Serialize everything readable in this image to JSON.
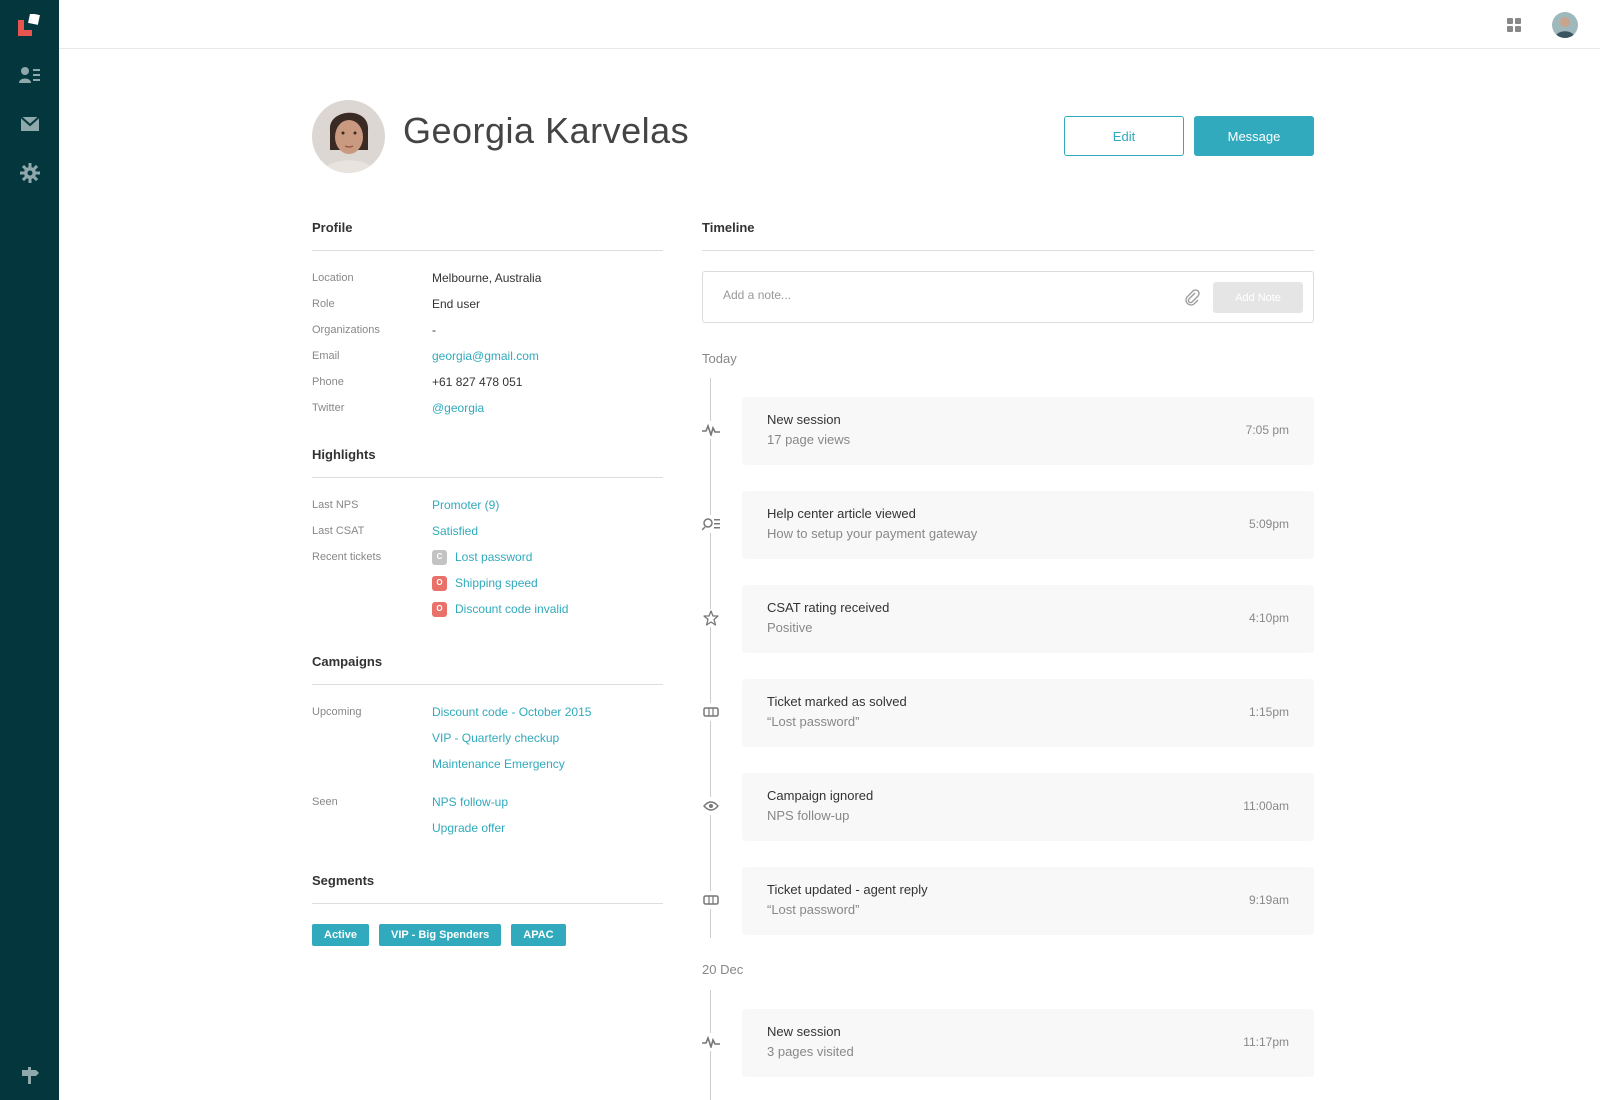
{
  "profile": {
    "name": "Georgia Karvelas",
    "edit_label": "Edit",
    "message_label": "Message"
  },
  "profile_section": {
    "title": "Profile",
    "fields": [
      {
        "key": "Location",
        "value": "Melbourne, Australia"
      },
      {
        "key": "Role",
        "value": "End user"
      },
      {
        "key": "Organizations",
        "value": "-"
      },
      {
        "key": "Email",
        "value": "georgia@gmail.com"
      },
      {
        "key": "Phone",
        "value": "+61 827 478 051"
      },
      {
        "key": "Twitter",
        "value": "@georgia"
      }
    ]
  },
  "highlights": {
    "title": "Highlights",
    "last_nps_label": "Last NPS",
    "last_nps_value": "Promoter (9)",
    "last_csat_label": "Last CSAT",
    "last_csat_value": "Satisfied",
    "recent_tickets_label": "Recent tickets",
    "tickets": [
      {
        "status": "C",
        "title": "Lost password"
      },
      {
        "status": "O",
        "title": "Shipping speed"
      },
      {
        "status": "O",
        "title": "Discount code invalid"
      }
    ]
  },
  "campaigns": {
    "title": "Campaigns",
    "upcoming_label": "Upcoming",
    "upcoming": [
      "Discount code - October 2015",
      "VIP - Quarterly checkup",
      "Maintenance Emergency"
    ],
    "seen_label": "Seen",
    "seen": [
      "NPS follow-up",
      "Upgrade offer"
    ]
  },
  "segments": {
    "title": "Segments",
    "tags": [
      "Active",
      "VIP - Big Spenders",
      "APAC"
    ]
  },
  "timeline": {
    "title": "Timeline",
    "note_placeholder": "Add a note...",
    "add_note_label": "Add Note",
    "day_today": "Today",
    "day_2": "20 Dec",
    "events": [
      {
        "icon": "activity-icon",
        "title": "New session",
        "subtitle": "17 page views",
        "time": "7:05 pm"
      },
      {
        "icon": "article-search-icon",
        "title": "Help center article viewed",
        "subtitle": "How to setup your payment gateway",
        "time": "5:09pm"
      },
      {
        "icon": "star-icon",
        "title": "CSAT rating received",
        "subtitle": "Positive",
        "time": "4:10pm"
      },
      {
        "icon": "ticket-icon",
        "title": "Ticket marked as solved",
        "subtitle": "“Lost password”",
        "time": "1:15pm"
      },
      {
        "icon": "eye-icon",
        "title": "Campaign ignored",
        "subtitle": "NPS follow-up",
        "time": "11:00am"
      },
      {
        "icon": "ticket-icon",
        "title": "Ticket updated - agent reply",
        "subtitle": "“Lost password”",
        "time": "9:19am"
      },
      {
        "icon": "activity-icon",
        "title": "New session",
        "subtitle": "3 pages visited",
        "time": "11:17pm"
      }
    ]
  },
  "colors": {
    "sidebar": "#03363d",
    "accent": "#30aabc",
    "logo": "#e8554e",
    "open_ticket": "#e8716a",
    "closed_ticket": "#c3c3c3"
  }
}
